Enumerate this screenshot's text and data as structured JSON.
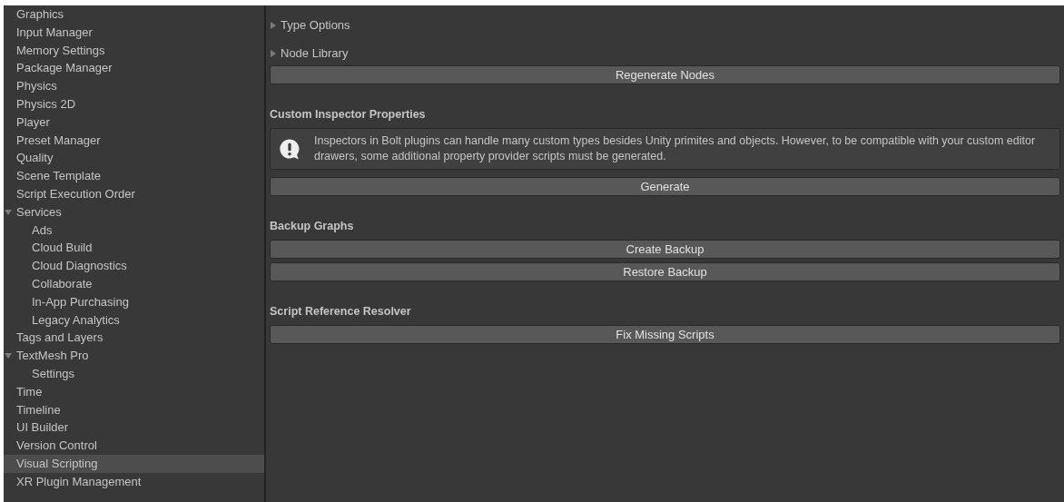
{
  "sidebar": {
    "items": [
      {
        "label": "Graphics",
        "selected": false
      },
      {
        "label": "Input Manager",
        "selected": false
      },
      {
        "label": "Memory Settings",
        "selected": false
      },
      {
        "label": "Package Manager",
        "selected": false
      },
      {
        "label": "Physics",
        "selected": false
      },
      {
        "label": "Physics 2D",
        "selected": false
      },
      {
        "label": "Player",
        "selected": false
      },
      {
        "label": "Preset Manager",
        "selected": false
      },
      {
        "label": "Quality",
        "selected": false
      },
      {
        "label": "Scene Template",
        "selected": false
      },
      {
        "label": "Script Execution Order",
        "selected": false
      },
      {
        "label": "Services",
        "selected": false,
        "expanded": true,
        "children": [
          {
            "label": "Ads",
            "selected": false
          },
          {
            "label": "Cloud Build",
            "selected": false
          },
          {
            "label": "Cloud Diagnostics",
            "selected": false
          },
          {
            "label": "Collaborate",
            "selected": false
          },
          {
            "label": "In-App Purchasing",
            "selected": false
          },
          {
            "label": "Legacy Analytics",
            "selected": false
          }
        ]
      },
      {
        "label": "Tags and Layers",
        "selected": false
      },
      {
        "label": "TextMesh Pro",
        "selected": false,
        "expanded": true,
        "children": [
          {
            "label": "Settings",
            "selected": false
          }
        ]
      },
      {
        "label": "Time",
        "selected": false
      },
      {
        "label": "Timeline",
        "selected": false
      },
      {
        "label": "UI Builder",
        "selected": false
      },
      {
        "label": "Version Control",
        "selected": false
      },
      {
        "label": "Visual Scripting",
        "selected": true
      },
      {
        "label": "XR Plugin Management",
        "selected": false
      }
    ]
  },
  "content": [
    {
      "kind": "foldout",
      "label": "Type Options",
      "expanded": false
    },
    {
      "kind": "foldout",
      "label": "Node Library",
      "expanded": false
    },
    {
      "kind": "button",
      "label": "Regenerate Nodes"
    },
    {
      "kind": "heading",
      "label": "Custom Inspector Properties"
    },
    {
      "kind": "help",
      "text": "Inspectors in Bolt plugins can handle many custom types besides Unity primites and objects. However, to be compatible with your custom editor drawers, some additional property provider scripts must be generated."
    },
    {
      "kind": "button",
      "label": "Generate"
    },
    {
      "kind": "heading",
      "label": "Backup Graphs"
    },
    {
      "kind": "button",
      "label": "Create Backup"
    },
    {
      "kind": "button",
      "label": "Restore Backup"
    },
    {
      "kind": "heading",
      "label": "Script Reference Resolver"
    },
    {
      "kind": "button",
      "label": "Fix Missing Scripts"
    }
  ]
}
